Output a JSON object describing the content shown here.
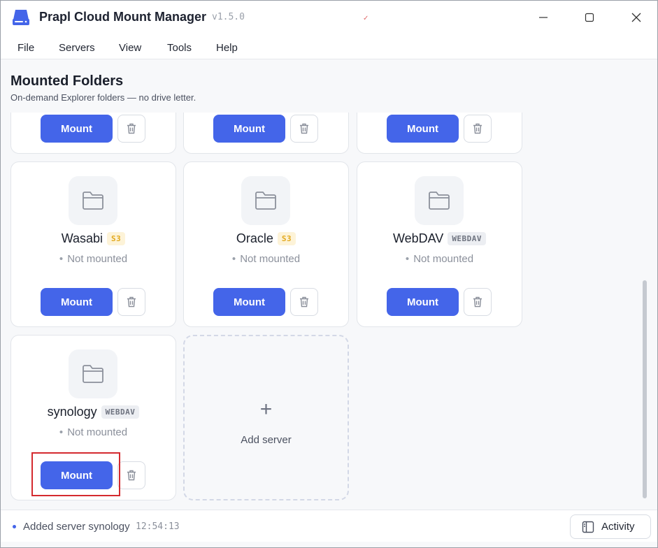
{
  "app": {
    "title": "Prapl Cloud Mount Manager",
    "version": "v1.5.0"
  },
  "menu": [
    "File",
    "Servers",
    "View",
    "Tools",
    "Help"
  ],
  "header": {
    "title": "Mounted Folders",
    "subtitle": "On-demand Explorer folders — no drive letter."
  },
  "buttons": {
    "mount": "Mount"
  },
  "servers": [
    {
      "name": "",
      "tag": "",
      "status": ""
    },
    {
      "name": "",
      "tag": "",
      "status": ""
    },
    {
      "name": "",
      "tag": "",
      "status": ""
    },
    {
      "name": "Wasabi",
      "tag": "S3",
      "status": "Not mounted"
    },
    {
      "name": "Oracle",
      "tag": "S3",
      "status": "Not mounted"
    },
    {
      "name": "WebDAV",
      "tag": "WEBDAV",
      "status": "Not mounted"
    },
    {
      "name": "synology",
      "tag": "WEBDAV",
      "status": "Not mounted"
    }
  ],
  "add_server": {
    "plus": "+",
    "label": "Add server"
  },
  "statusbar": {
    "message": "Added server synology",
    "time": "12:54:13",
    "activity_label": "Activity"
  },
  "colors": {
    "accent": "#4465e9",
    "s3_tag": "#e2a81c",
    "highlight": "#d42a2f"
  },
  "icons": {
    "app": "drive-icon",
    "folder": "folder-icon",
    "trash": "trash-icon",
    "activity": "panel-icon"
  }
}
